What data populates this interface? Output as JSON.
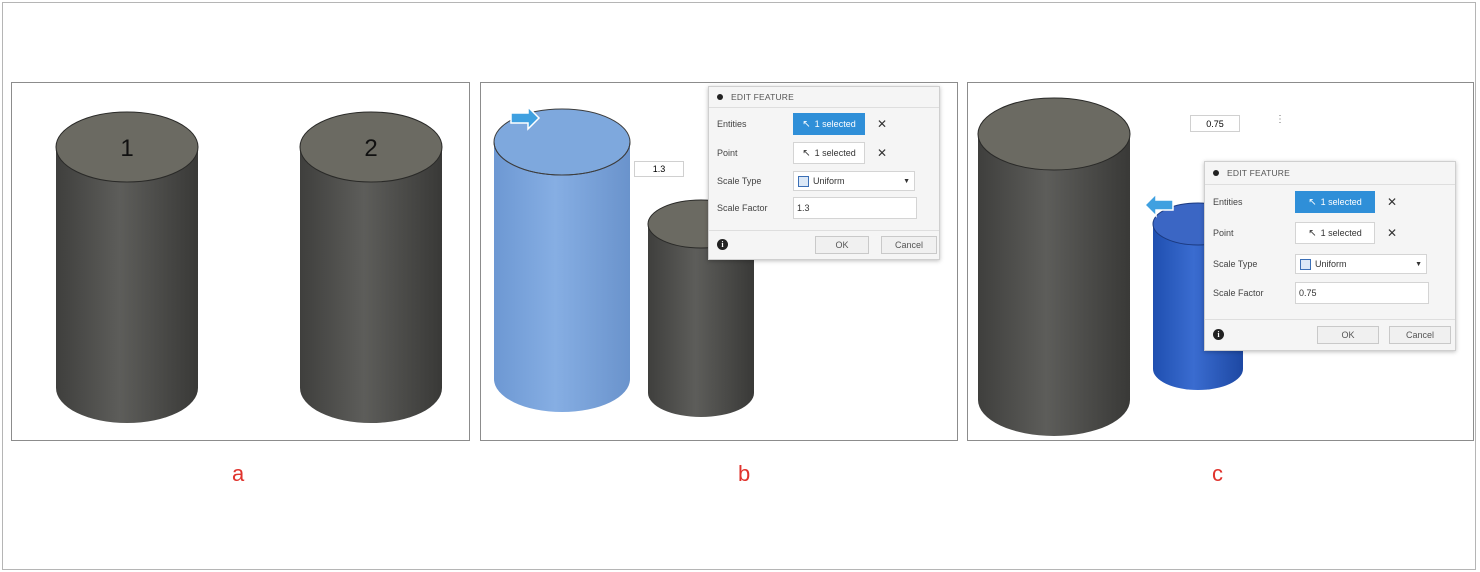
{
  "panel_a": {
    "caption": "a",
    "cylinder_labels": [
      "1",
      "2"
    ]
  },
  "panel_b": {
    "caption": "b",
    "scale_input": "1.3",
    "dialog": {
      "title": "EDIT FEATURE",
      "entities_label": "Entities",
      "entities_value": "1 selected",
      "point_label": "Point",
      "point_value": "1 selected",
      "scale_type_label": "Scale Type",
      "scale_type_value": "Uniform",
      "scale_factor_label": "Scale Factor",
      "scale_factor_value": "1.3",
      "ok": "OK",
      "cancel": "Cancel"
    }
  },
  "panel_c": {
    "caption": "c",
    "scale_input": "0.75",
    "dialog": {
      "title": "EDIT FEATURE",
      "entities_label": "Entities",
      "entities_value": "1 selected",
      "point_label": "Point",
      "point_value": "1 selected",
      "scale_type_label": "Scale Type",
      "scale_type_value": "Uniform",
      "scale_factor_label": "Scale Factor",
      "scale_factor_value": "0.75",
      "ok": "OK",
      "cancel": "Cancel"
    }
  },
  "colors": {
    "cylinder_gray": "#4f4f4c",
    "cylinder_top_gray": "#6b6a62",
    "selected_blue_light": "#7aa5dc",
    "selected_blue_dark": "#2d5fbf",
    "caption_red": "#e0332d",
    "accent": "#2f8fd8"
  }
}
